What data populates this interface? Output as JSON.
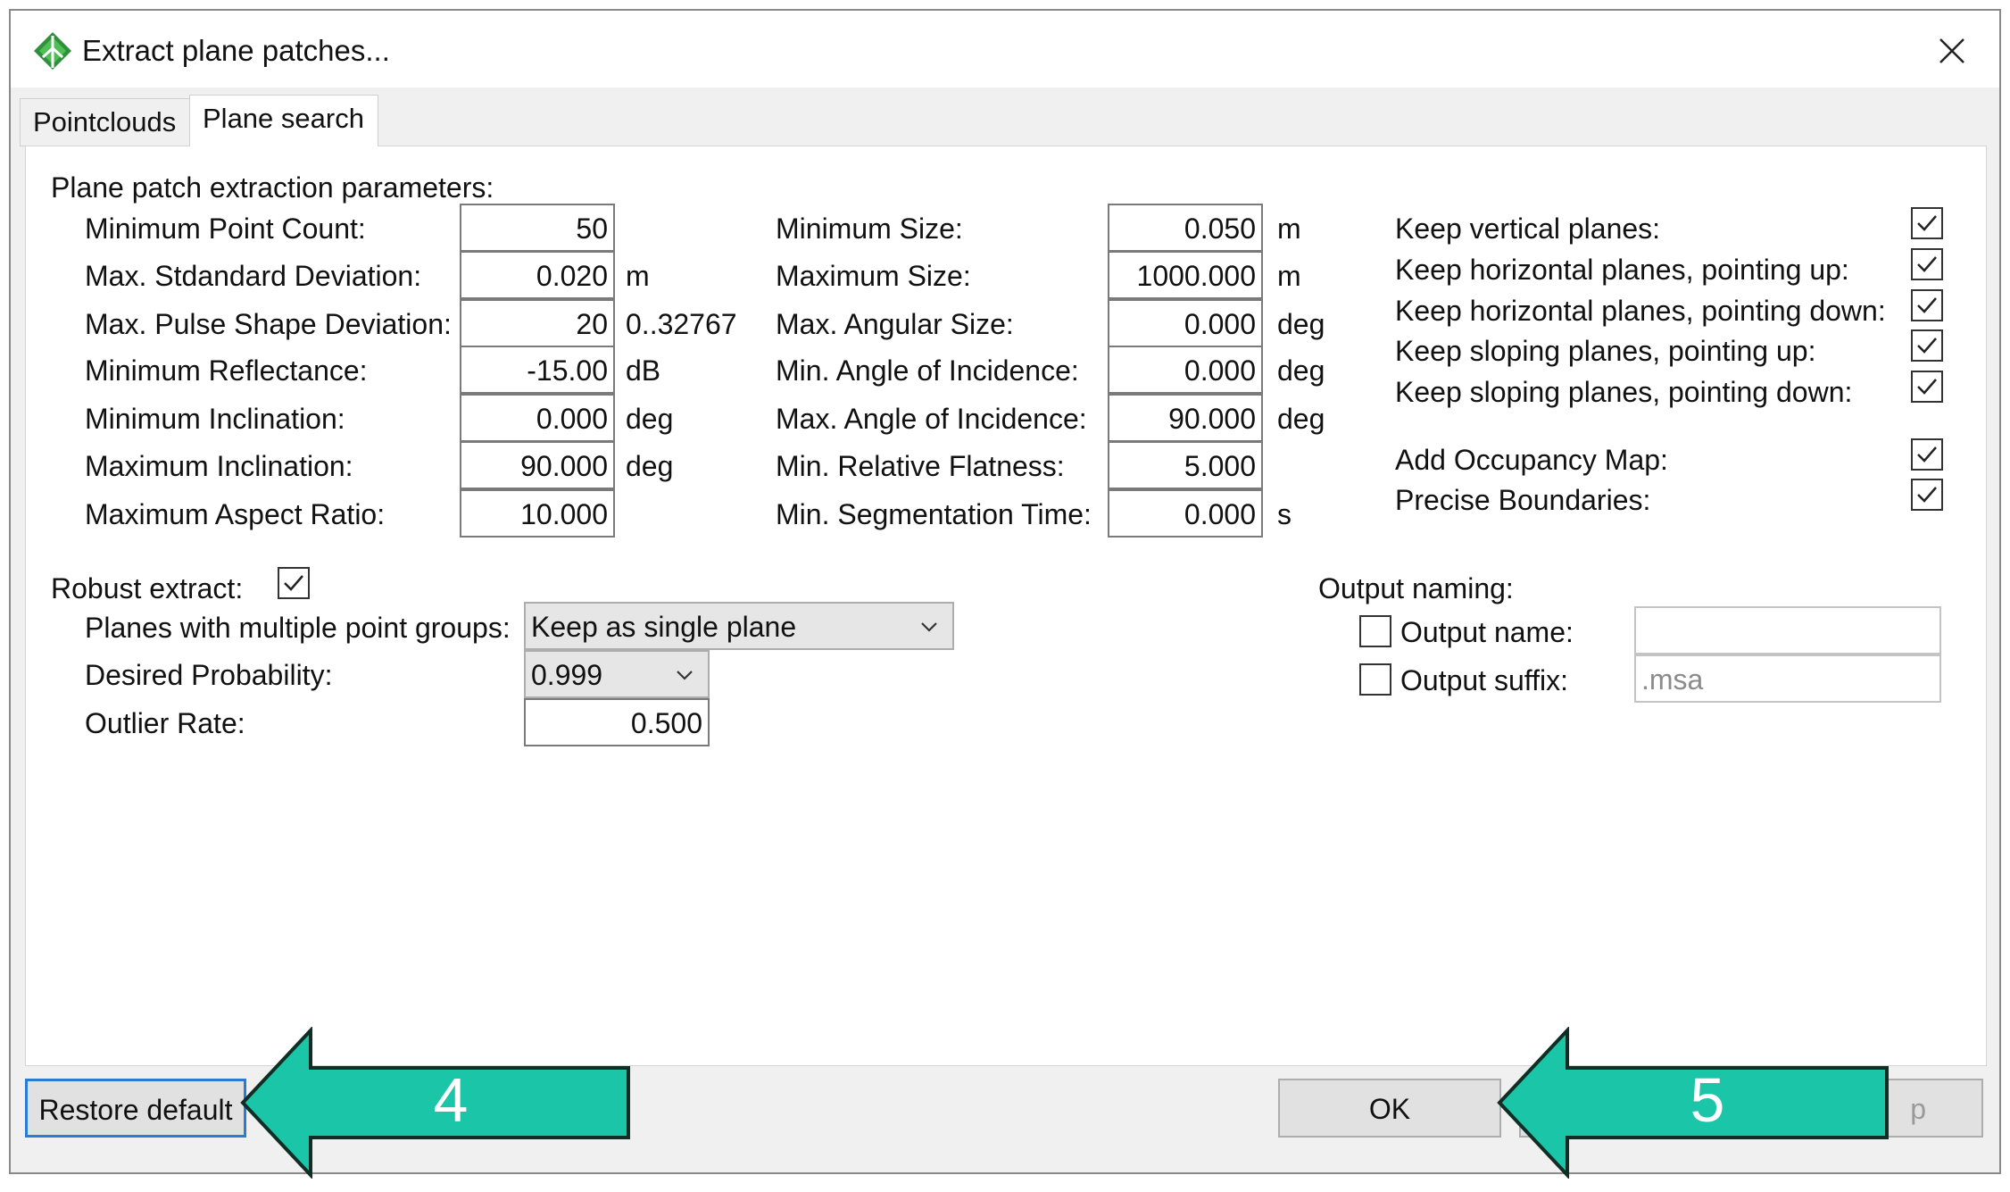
{
  "window": {
    "title": "Extract plane patches...",
    "icon": "app-logo-icon",
    "close_icon": "close-icon"
  },
  "tabs": [
    {
      "label": "Pointclouds",
      "active": false
    },
    {
      "label": "Plane search",
      "active": true
    }
  ],
  "section_title": "Plane patch extraction parameters:",
  "params_left": [
    {
      "label": "Minimum Point Count:",
      "value": "50",
      "unit": ""
    },
    {
      "label": "Max. Stdandard Deviation:",
      "value": "0.020",
      "unit": "m"
    },
    {
      "label": "Max. Pulse Shape Deviation:",
      "value": "20",
      "unit": "0..32767"
    },
    {
      "label": "Minimum Reflectance:",
      "value": "-15.00",
      "unit": "dB"
    },
    {
      "label": "Minimum Inclination:",
      "value": "0.000",
      "unit": "deg"
    },
    {
      "label": "Maximum Inclination:",
      "value": "90.000",
      "unit": "deg"
    },
    {
      "label": "Maximum Aspect Ratio:",
      "value": "10.000",
      "unit": ""
    }
  ],
  "params_mid": [
    {
      "label": "Minimum Size:",
      "value": "0.050",
      "unit": "m"
    },
    {
      "label": "Maximum Size:",
      "value": "1000.000",
      "unit": "m"
    },
    {
      "label": "Max. Angular Size:",
      "value": "0.000",
      "unit": "deg"
    },
    {
      "label": "Min. Angle of Incidence:",
      "value": "0.000",
      "unit": "deg"
    },
    {
      "label": "Max. Angle of Incidence:",
      "value": "90.000",
      "unit": "deg"
    },
    {
      "label": "Min. Relative Flatness:",
      "value": "5.000",
      "unit": ""
    },
    {
      "label": "Min. Segmentation Time:",
      "value": "0.000",
      "unit": "s"
    }
  ],
  "options_right": [
    {
      "label": "Keep vertical planes:",
      "checked": true
    },
    {
      "label": "Keep horizontal planes, pointing up:",
      "checked": true
    },
    {
      "label": "Keep horizontal planes, pointing down:",
      "checked": true
    },
    {
      "label": "Keep sloping planes, pointing up:",
      "checked": true
    },
    {
      "label": "Keep sloping planes, pointing down:",
      "checked": true
    },
    {
      "label": "Add Occupancy Map:",
      "checked": true
    },
    {
      "label": "Precise Boundaries:",
      "checked": true
    }
  ],
  "robust": {
    "label": "Robust extract:",
    "checked": true,
    "multi_groups_label": "Planes with multiple point groups:",
    "multi_groups_value": "Keep as single plane",
    "probability_label": "Desired Probability:",
    "probability_value": "0.999",
    "outlier_label": "Outlier Rate:",
    "outlier_value": "0.500"
  },
  "output": {
    "title": "Output naming:",
    "name_label": "Output name:",
    "name_checked": false,
    "name_value": "",
    "suffix_label": "Output suffix:",
    "suffix_checked": false,
    "suffix_placeholder": ".msa"
  },
  "buttons": {
    "restore": "Restore default",
    "ok": "OK",
    "hidden_partial": "p"
  },
  "annotations": [
    {
      "number": "4",
      "color": "#1bc5a8"
    },
    {
      "number": "5",
      "color": "#1bc5a8"
    }
  ]
}
